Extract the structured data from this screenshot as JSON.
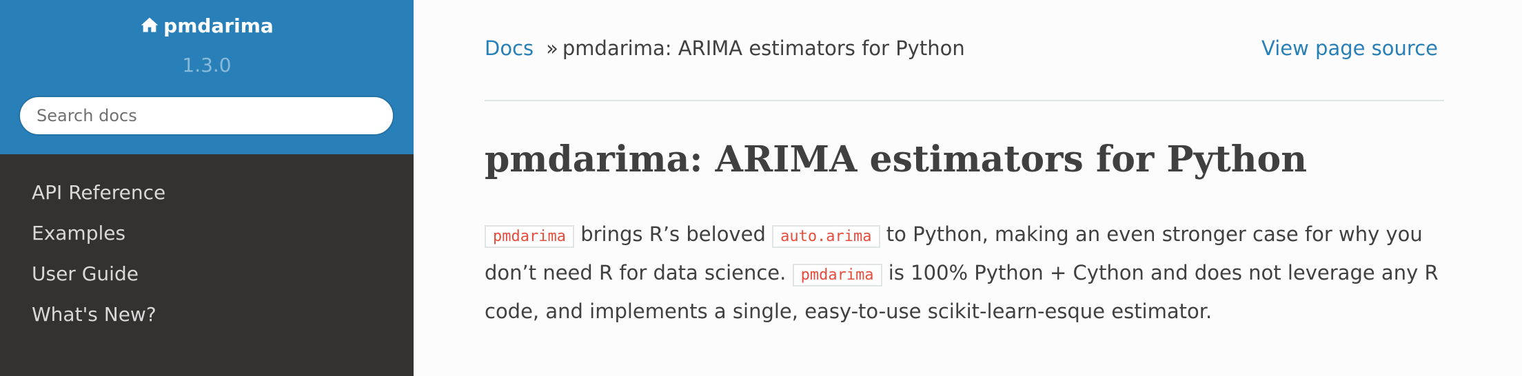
{
  "sidebar": {
    "brand": "pmdarima",
    "version": "1.3.0",
    "search_placeholder": "Search docs",
    "nav": [
      {
        "label": "API Reference"
      },
      {
        "label": "Examples"
      },
      {
        "label": "User Guide"
      },
      {
        "label": "What's New?"
      }
    ]
  },
  "breadcrumbs": {
    "root": "Docs",
    "separator": "»",
    "current": "pmdarima: ARIMA estimators for Python",
    "view_source": "View page source"
  },
  "page": {
    "title": "pmdarima: ARIMA estimators for Python",
    "paragraph": {
      "code1": "pmdarima",
      "text1": "brings R’s beloved",
      "code2": "auto.arima",
      "text2": "to Python, making an even stronger case for why you don’t need R for data science.",
      "code3": "pmdarima",
      "text3": "is 100% Python + Cython and does not leverage any R code, and implements a single, easy-to-use scikit-learn-esque estimator."
    }
  },
  "colors": {
    "sidebar_top": "#2980b9",
    "sidebar_body": "#343131",
    "link": "#2980b9",
    "code": "#e74c3c"
  },
  "icons": {
    "brand": "home-icon"
  }
}
